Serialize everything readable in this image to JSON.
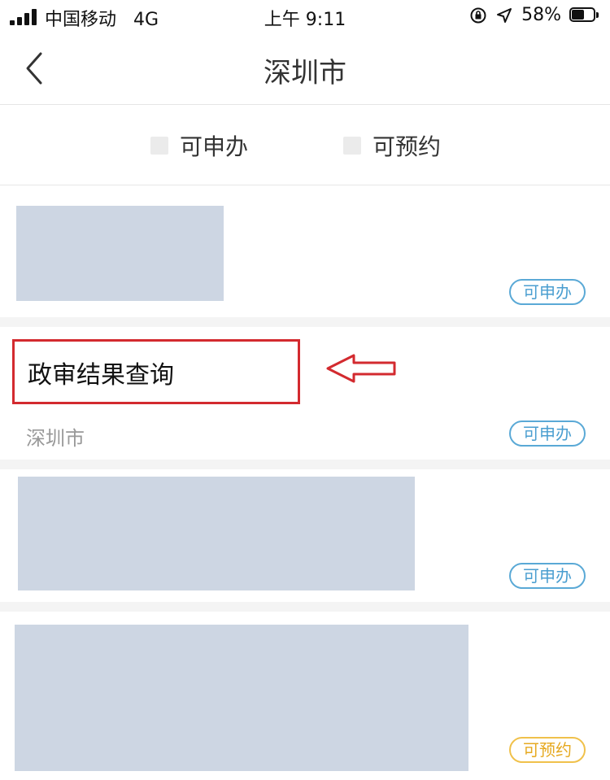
{
  "status_bar": {
    "carrier": "中国移动",
    "network": "4G",
    "time": "上午 9:11",
    "battery_percent": "58%",
    "battery_level": 0.58
  },
  "nav": {
    "title": "深圳市"
  },
  "filters": [
    {
      "label": "可申办"
    },
    {
      "label": "可预约"
    }
  ],
  "cards": [
    {
      "badge": "可申办"
    },
    {
      "title": "政审结果查询",
      "region": "深圳市",
      "badge": "可申办"
    },
    {
      "badge": "可申办"
    },
    {
      "badge": "可预约"
    }
  ],
  "colors": {
    "badge_blue": "#4a9ed0",
    "badge_orange": "#e6a920",
    "annotation_red": "#d32a2f",
    "redacted": "#cdd6e3"
  }
}
